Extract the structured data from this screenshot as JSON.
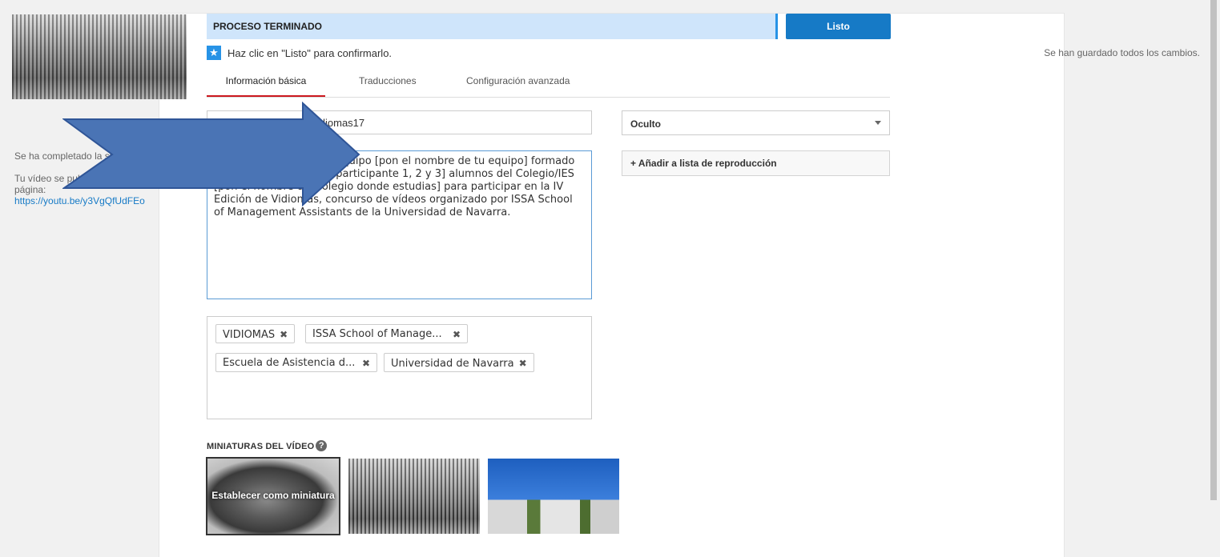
{
  "status": {
    "banner": "PROCESO TERMINADO",
    "done_button": "Listo",
    "hint": "Haz clic en \"Listo\" para confirmarlo.",
    "saved": "Se han guardado todos los cambios."
  },
  "tabs": [
    {
      "label": "Información básica",
      "active": true
    },
    {
      "label": "Traducciones",
      "active": false
    },
    {
      "label": "Configuración avanzada",
      "active": false
    }
  ],
  "upload": {
    "complete": "Se ha completado la subida.",
    "publish_note": "Tu vídeo se publicará en la siguiente página:",
    "url": "https://youtu.be/y3VgQfUdFEo"
  },
  "form": {
    "title": "Nombre del vídeo | #Vidiomas17",
    "description": "“Vídeo realizado por el equipo [pon el nombre de tu equipo] formado por [nombre y apellido participante 1, 2 y 3] alumnos del Colegio/IES [pon el nombre del colegio donde estudias] para participar en la IV Edición de Vidiomas, concurso de vídeos organizado por ISSA School of Management Assistants de la Universidad de Navarra.",
    "privacy": "Oculto",
    "playlist_button": "+ Añadir a lista de reproducción",
    "tags": [
      "VIDIOMAS",
      "ISSA School of Manage...",
      "Escuela de Asistencia d...",
      "Universidad de Navarra"
    ]
  },
  "thumbnails": {
    "label": "MINIATURAS DEL VÍDEO",
    "set_label": "Establecer como miniatura"
  },
  "colors": {
    "accent": "#167ac6",
    "banner_bg": "#cfe5fb",
    "active_tab": "#cc181e",
    "arrow": "#4a74b5"
  }
}
